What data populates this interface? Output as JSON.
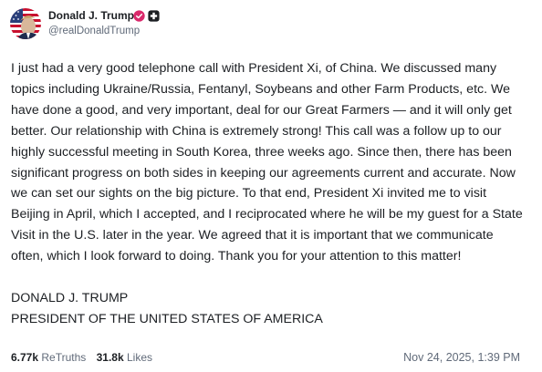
{
  "author": {
    "display_name": "Donald J. Trump",
    "handle": "@realDonaldTrump",
    "verified_color": "#d9296b"
  },
  "post": {
    "paragraph": "I just had a very good telephone call with President Xi, of China. We discussed many topics including Ukraine/Russia, Fentanyl, Soybeans and other Farm Products, etc. We have done a good, and very important, deal for our Great Farmers — and it will only get better. Our relationship with China is extremely strong! This call was a follow up to our highly successful meeting in South Korea, three weeks ago. Since then, there has been significant progress on both sides in keeping our agreements current and accurate. Now we can set our sights on the big picture. To that end, President Xi invited me to visit Beijing in April, which I accepted, and I reciprocated where he will be my guest for a State Visit in the U.S. later in the year. We agreed that it is important that we communicate often, which I look forward to doing. Thank you for your attention to this matter!",
    "signature_name": "DONALD J. TRUMP",
    "signature_title": "PRESIDENT OF THE UNITED STATES OF AMERICA"
  },
  "stats": {
    "retruths_count": "6.77k",
    "retruths_label": "ReTruths",
    "likes_count": "31.8k",
    "likes_label": "Likes"
  },
  "timestamp": "Nov 24, 2025, 1:39 PM"
}
